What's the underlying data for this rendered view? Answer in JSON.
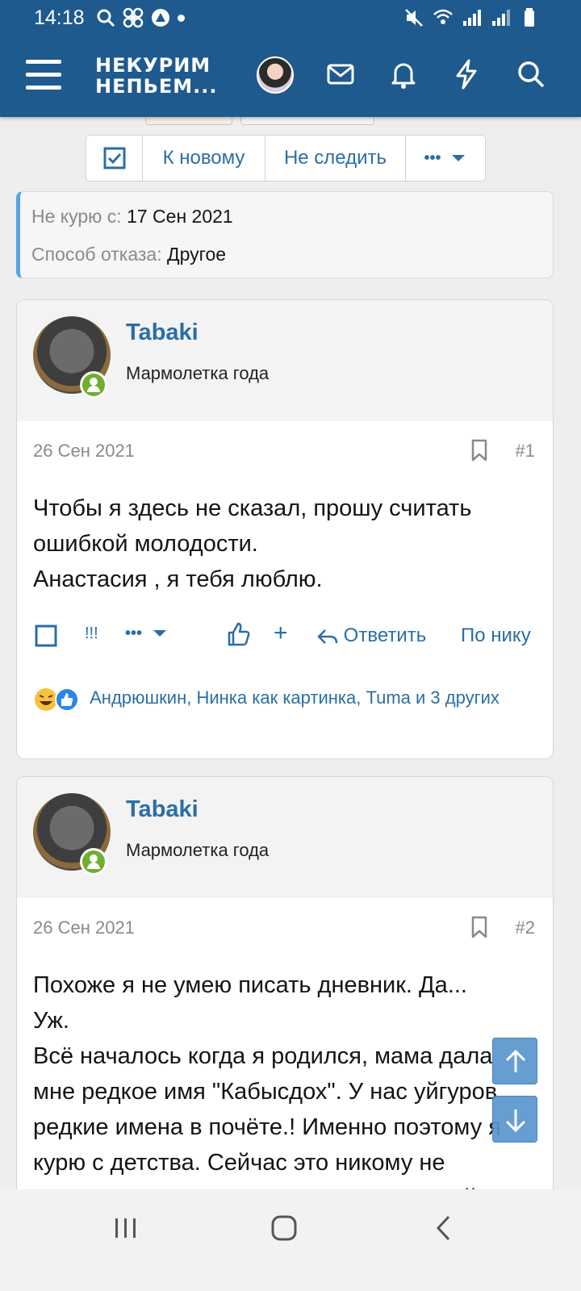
{
  "status": {
    "time": "14:18"
  },
  "header": {
    "logo_line1": "НЕКУРИМ",
    "logo_line2": "НЕПЬЕМ..."
  },
  "toolbar": {
    "new_label": "К новому",
    "unwatch_label": "Не следить",
    "more_label": "•••"
  },
  "info": {
    "quit_label": "Не курю с:",
    "quit_value": "17 Сен 2021",
    "method_label": "Способ отказа:",
    "method_value": "Другое"
  },
  "posts": [
    {
      "user": "Tabaki",
      "role": "Мармолетка года",
      "date": "26 Сен 2021",
      "number": "#1",
      "lines": [
        "Чтобы я здесь не сказал, прошу считать",
        "ошибкой молодости.",
        "Анастасия , я тебя люблю."
      ],
      "actions": {
        "report": "!!!",
        "more": "•••",
        "plus": "+",
        "reply": "Ответить",
        "by_nick": "По нику"
      },
      "reactions_text": "Андрюшкин, Нинка как картинка, Tuma и 3 других"
    },
    {
      "user": "Tabaki",
      "role": "Мармолетка года",
      "date": "26 Сен 2021",
      "number": "#2",
      "lines": [
        "Похоже я не умею писать дневник. Да...",
        "Уж.",
        "Всё началось когда я родился, мама дала",
        "мне редкое имя \"Кабысдох\". У нас уйгуров",
        "редкие имена в почёте.! Именно поэтому я",
        "курю с детства. Сейчас это никому не",
        "интересно, но я считаю моё имя детской"
      ]
    }
  ],
  "colors": {
    "header_bg": "#1e5a8e",
    "link": "#2a6ea6",
    "online": "#6fae2f",
    "accent_border": "#5aa3e0"
  }
}
